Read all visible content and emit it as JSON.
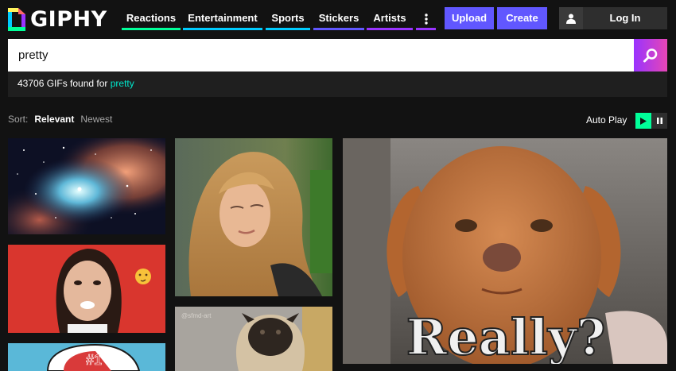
{
  "brand": {
    "name": "GIPHY"
  },
  "nav": [
    {
      "label": "Reactions",
      "color": "#00ff99"
    },
    {
      "label": "Entertainment",
      "color": "#00ccff"
    },
    {
      "label": "Sports",
      "color": "#00ccff"
    },
    {
      "label": "Stickers",
      "color": "#6157ff"
    },
    {
      "label": "Artists",
      "color": "#9933ff"
    }
  ],
  "more_icon": "vertical-ellipsis-icon",
  "buttons": {
    "upload": "Upload",
    "create": "Create",
    "login": "Log In"
  },
  "search": {
    "value": "pretty",
    "icon": "search-icon"
  },
  "results": {
    "prefix": "43706 GIFs found for",
    "query": "pretty"
  },
  "sort": {
    "label": "Sort:",
    "options": [
      "Relevant",
      "Newest"
    ],
    "selected": "Relevant"
  },
  "autoplay": {
    "label": "Auto Play",
    "state": "on"
  },
  "gifs": {
    "really_caption": "Really?",
    "pug_watermark": "@sfmd-art",
    "badge": "#1"
  },
  "colors": {
    "accent": "#6157ff",
    "search_gradient": "#9933ff",
    "autoplay_on": "#00ff99",
    "query_highlight": "#00e6cc"
  }
}
